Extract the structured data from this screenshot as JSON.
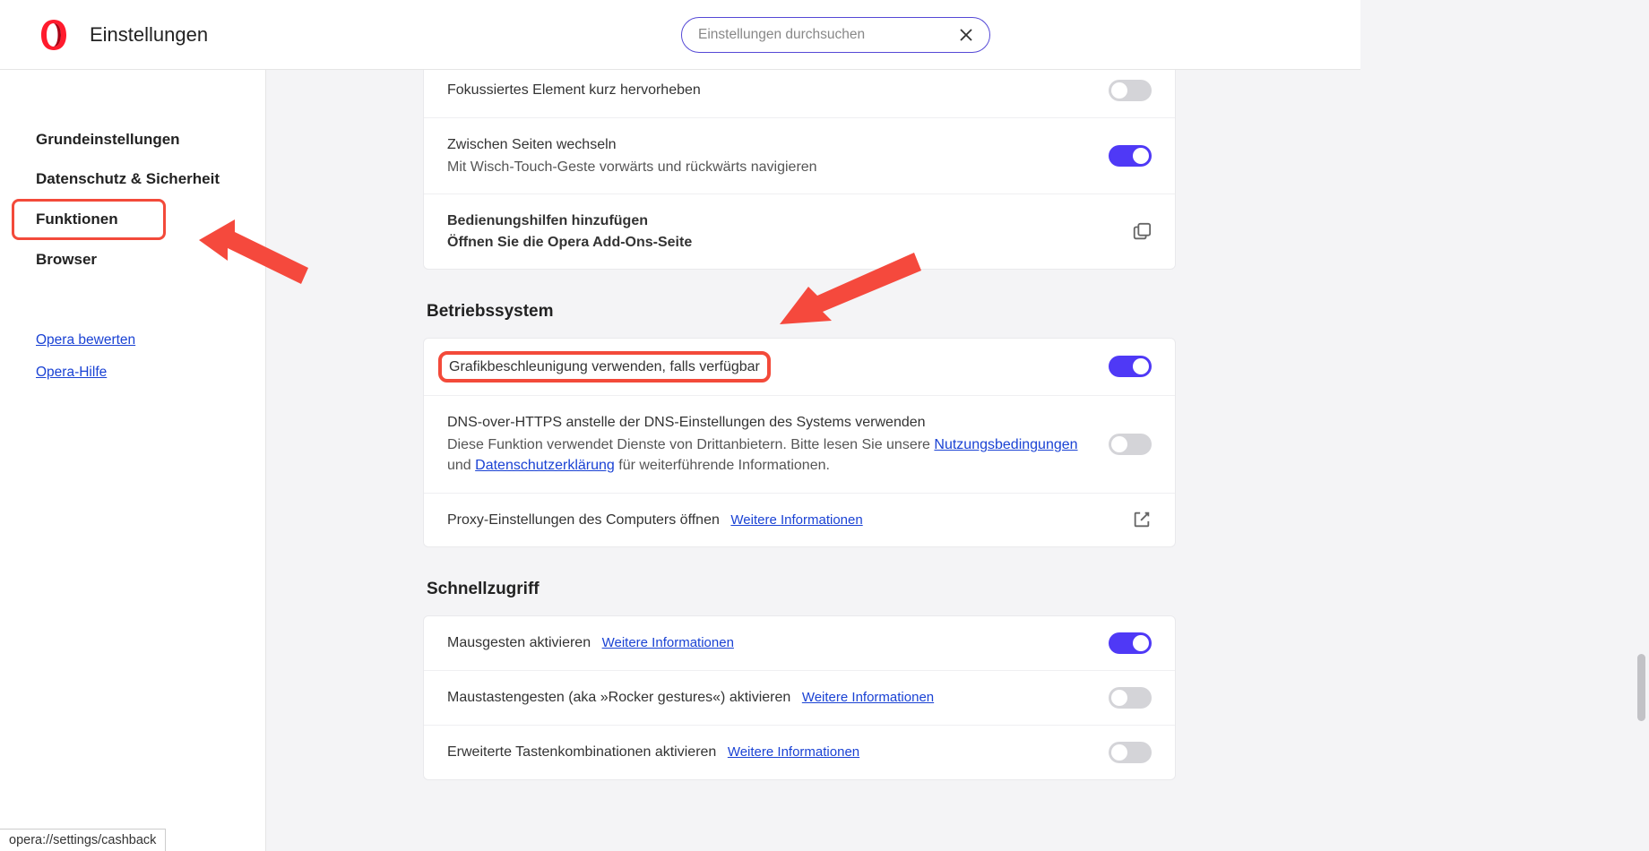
{
  "header": {
    "title": "Einstellungen",
    "search_placeholder": "Einstellungen durchsuchen"
  },
  "sidebar": {
    "items": [
      {
        "label": "Grundeinstellungen"
      },
      {
        "label": "Datenschutz & Sicherheit"
      },
      {
        "label": "Funktionen"
      },
      {
        "label": "Browser"
      }
    ],
    "links": [
      {
        "label": "Opera bewerten"
      },
      {
        "label": "Opera-Hilfe"
      }
    ]
  },
  "sections": {
    "top_rows": {
      "focus": "Fokussiertes Element kurz hervorheben",
      "swipe_title": "Zwischen Seiten wechseln",
      "swipe_sub": "Mit Wisch-Touch-Geste vorwärts und rückwärts navigieren",
      "addons_title": "Bedienungshilfen hinzufügen",
      "addons_sub": "Öffnen Sie die Opera Add-Ons-Seite"
    },
    "os": {
      "title": "Betriebssystem",
      "gpu": "Grafikbeschleunigung verwenden, falls verfügbar",
      "dns_title": "DNS-over-HTTPS anstelle der DNS-Einstellungen des Systems verwenden",
      "dns_sub_pre": "Diese Funktion verwendet Dienste von Drittanbietern. Bitte lesen Sie unsere",
      "dns_terms": "Nutzungsbedingungen",
      "dns_and": "und",
      "dns_privacy": "Datenschutzerklärung",
      "dns_sub_post": "für weiterführende Informationen.",
      "proxy": "Proxy-Einstellungen des Computers öffnen",
      "proxy_more": "Weitere Informationen"
    },
    "quick": {
      "title": "Schnellzugriff",
      "mouse": "Mausgesten aktivieren",
      "mouse_more": "Weitere Informationen",
      "rocker": "Maustastengesten (aka »Rocker gestures«) aktivieren",
      "rocker_more": "Weitere Informationen",
      "keys": "Erweiterte Tastenkombinationen aktivieren",
      "keys_more": "Weitere Informationen"
    }
  },
  "status_url": "opera://settings/cashback"
}
